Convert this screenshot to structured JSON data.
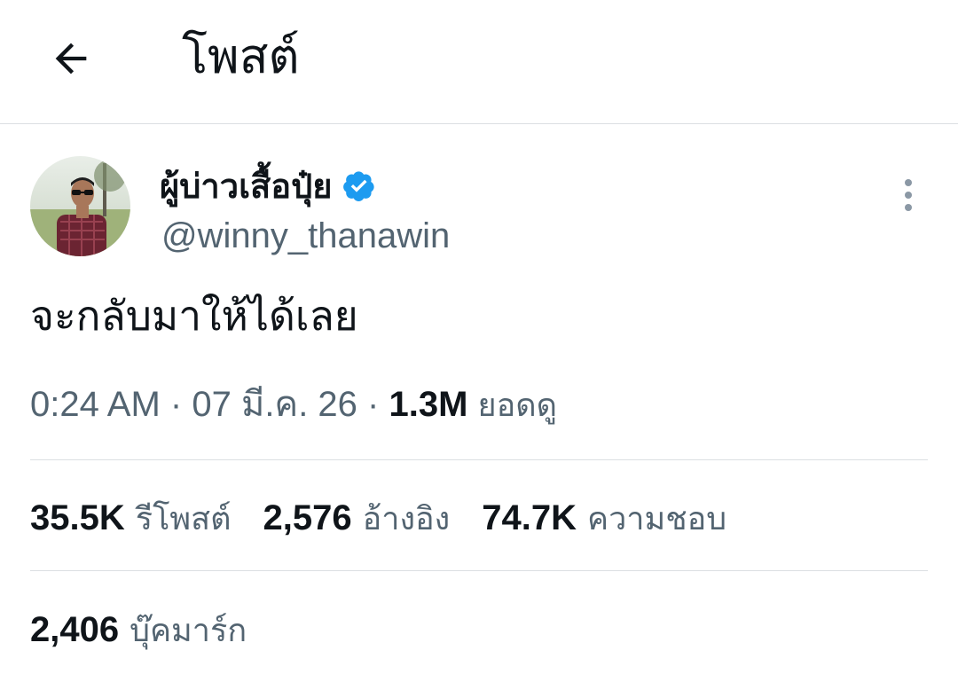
{
  "header": {
    "title": "โพสต์",
    "back_icon": "arrow-left-icon"
  },
  "author": {
    "display_name": "ผู้บ่าวเสื้อปุ๋ย",
    "handle": "@winny_thanawin",
    "verified": true,
    "verified_color": "#1d9bf0"
  },
  "post": {
    "text": "จะกลับมาให้ได้เลย",
    "time": "0:24 AM",
    "separator": "·",
    "date": "07 มี.ค. 26",
    "views_count": "1.3M",
    "views_label": "ยอดดู"
  },
  "stats": [
    {
      "count": "35.5K",
      "label": "รีโพสต์"
    },
    {
      "count": "2,576",
      "label": "อ้างอิง"
    },
    {
      "count": "74.7K",
      "label": "ความชอบ"
    }
  ],
  "bookmarks": {
    "count": "2,406",
    "label": "บุ๊คมาร์ก"
  },
  "colors": {
    "text_primary": "#0f1419",
    "text_secondary": "#536471",
    "divider": "#dcdfe2",
    "accent": "#1d9bf0"
  }
}
